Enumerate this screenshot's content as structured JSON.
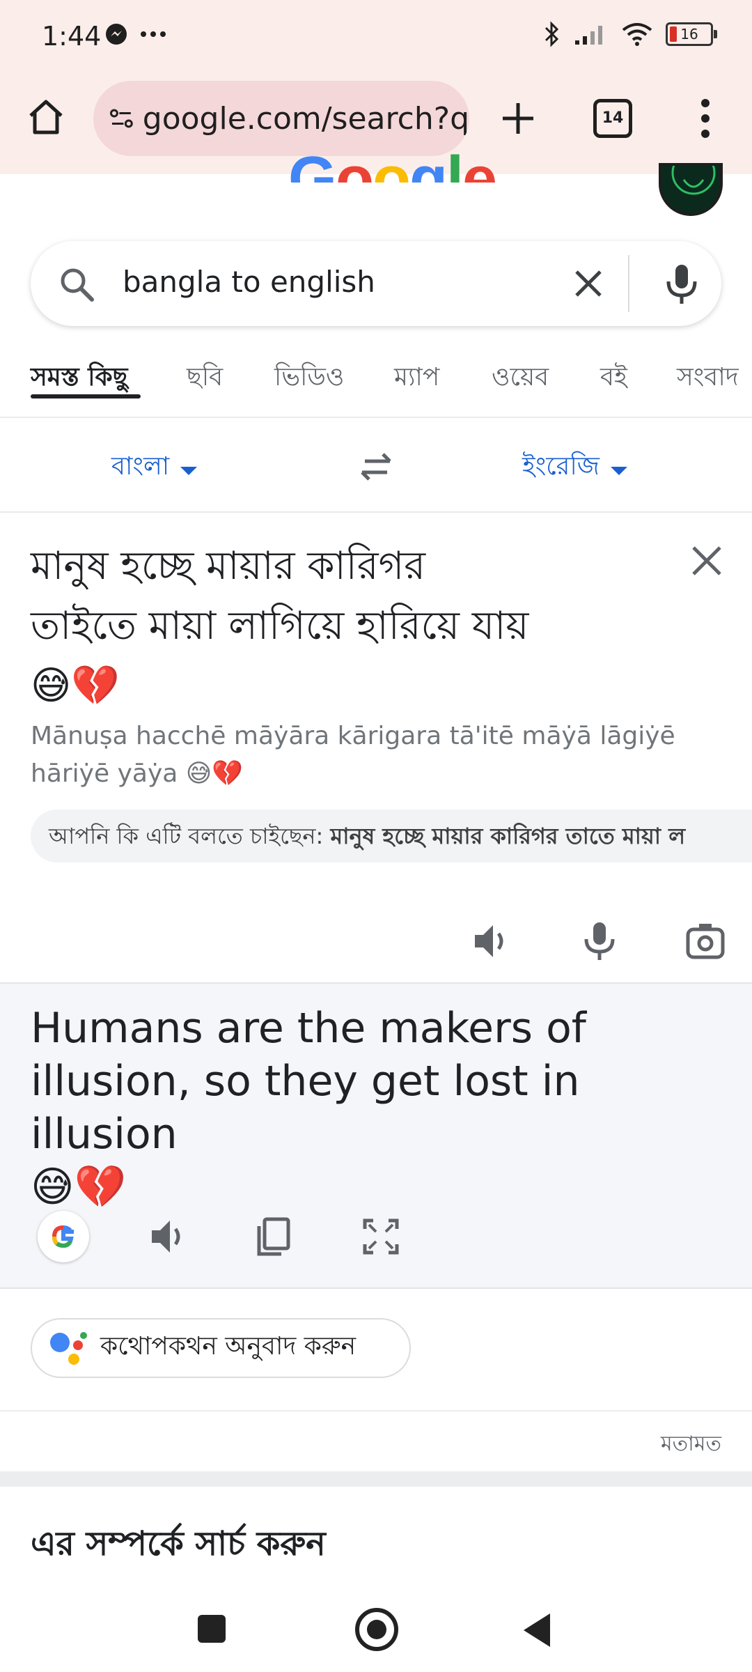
{
  "status_bar": {
    "time": "1:44",
    "battery": "16"
  },
  "browser": {
    "url": "google.com/search?q",
    "tab_count": "14"
  },
  "google_logo": "Google",
  "search": {
    "query": "bangla to english"
  },
  "tabs": [
    "সমস্ত কিছু",
    "ছবি",
    "ভিডিও",
    "ম্যাপ",
    "ওয়েব",
    "বই",
    "সংবাদ"
  ],
  "translator": {
    "source_lang": "বাংলা",
    "target_lang": "ইংরেজি",
    "source_line1": "মানুষ হচ্ছে মায়ার কারিগর",
    "source_line2": "তাইতে মায়া লাগিয়ে হারিয়ে যায়",
    "source_emoji": "😅💔",
    "transliteration": "Mānuṣa hacchē māẏāra kārigara tā'itē māẏā lāgiẏē hāriẏē yāẏa 😅💔",
    "suggest_prefix": "আপনি কি এটি বলতে চাইছেন:",
    "suggest_text": "মানুষ হচ্ছে মায়ার কারিগর তাতে মায়া ল",
    "target_text": "Humans are the makers of illusion, so they get lost in illusion",
    "target_emoji": "😅💔"
  },
  "conversation_chip": "কথোপকথন অনুবাদ করুন",
  "feedback": "মতামত",
  "related_title": "এর সম্পর্কে সার্চ করুন",
  "colors": {
    "link_blue": "#1a5fd0",
    "chrome_bg": "#fbeeea",
    "url_pill": "#f4d7d9"
  }
}
